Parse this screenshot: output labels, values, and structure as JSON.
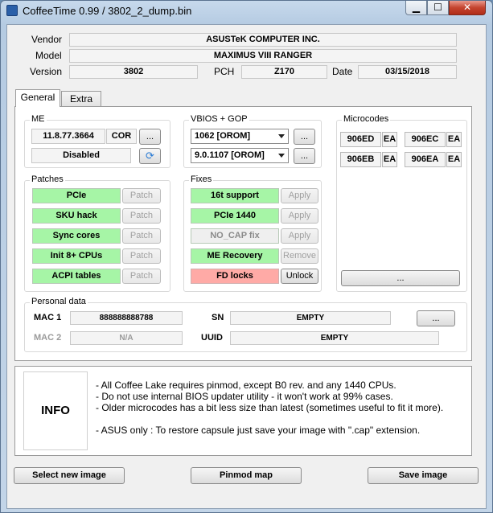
{
  "window": {
    "title": "CoffeeTime 0.99  /  3802_2_dump.bin",
    "close_glyph": "✕"
  },
  "header": {
    "vendor_label": "Vendor",
    "vendor_value": "ASUSTeK COMPUTER INC.",
    "model_label": "Model",
    "model_value": "MAXIMUS VIII RANGER",
    "version_label": "Version",
    "version_value": "3802",
    "pch_label": "PCH",
    "pch_value": "Z170",
    "date_label": "Date",
    "date_value": "03/15/2018"
  },
  "tabs": [
    {
      "label": "General"
    },
    {
      "label": "Extra"
    }
  ],
  "me": {
    "title": "ME",
    "version": "11.8.77.3664",
    "type": "COR",
    "browse_label": "...",
    "state": "Disabled",
    "refresh_glyph": "⟳"
  },
  "vbios": {
    "title": "VBIOS + GOP",
    "vbios_selected": "1062 [OROM]",
    "gop_selected": "9.0.1107 [OROM]",
    "browse_label": "..."
  },
  "microcodes": {
    "title": "Microcodes",
    "items": [
      {
        "cpuid": "906ED",
        "platform": "EA"
      },
      {
        "cpuid": "906EC",
        "platform": "EA"
      },
      {
        "cpuid": "906EB",
        "platform": "EA"
      },
      {
        "cpuid": "906EA",
        "platform": "EA"
      }
    ],
    "browse_label": "..."
  },
  "patches": {
    "title": "Patches",
    "items": [
      {
        "name": "PCIe",
        "action": "Patch"
      },
      {
        "name": "SKU hack",
        "action": "Patch"
      },
      {
        "name": "Sync cores",
        "action": "Patch"
      },
      {
        "name": "Init 8+ CPUs",
        "action": "Patch"
      },
      {
        "name": "ACPI tables",
        "action": "Patch"
      }
    ]
  },
  "fixes": {
    "title": "Fixes",
    "items": [
      {
        "name": "16t support",
        "action": "Apply"
      },
      {
        "name": "PCIe 1440",
        "action": "Apply"
      },
      {
        "name": "NO_CAP fix",
        "action": "Apply"
      },
      {
        "name": "ME Recovery",
        "action": "Remove"
      },
      {
        "name": "FD locks",
        "action": "Unlock"
      }
    ]
  },
  "personal": {
    "title": "Personal data",
    "mac1_label": "MAC 1",
    "mac1_value": "888888888788",
    "mac2_label": "MAC 2",
    "mac2_value": "N/A",
    "sn_label": "SN",
    "sn_value": "EMPTY",
    "uuid_label": "UUID",
    "uuid_value": "EMPTY",
    "browse_label": "..."
  },
  "info": {
    "label": "INFO",
    "lines": [
      "- All Coffee Lake requires pinmod, except B0 rev. and any 1440 CPUs.",
      "- Do not use internal BIOS updater utility - it won't work at 99% cases.",
      "- Older microcodes has a bit less size than latest (sometimes useful to fit it more).",
      "- ASUS only : To restore capsule just save your image with \".cap\" extension."
    ]
  },
  "footer": {
    "select_label": "Select new image",
    "pinmod_label": "Pinmod map",
    "save_label": "Save image"
  },
  "colors": {
    "enabled": "#a6f5a6",
    "locked": "#ffaaa6"
  }
}
